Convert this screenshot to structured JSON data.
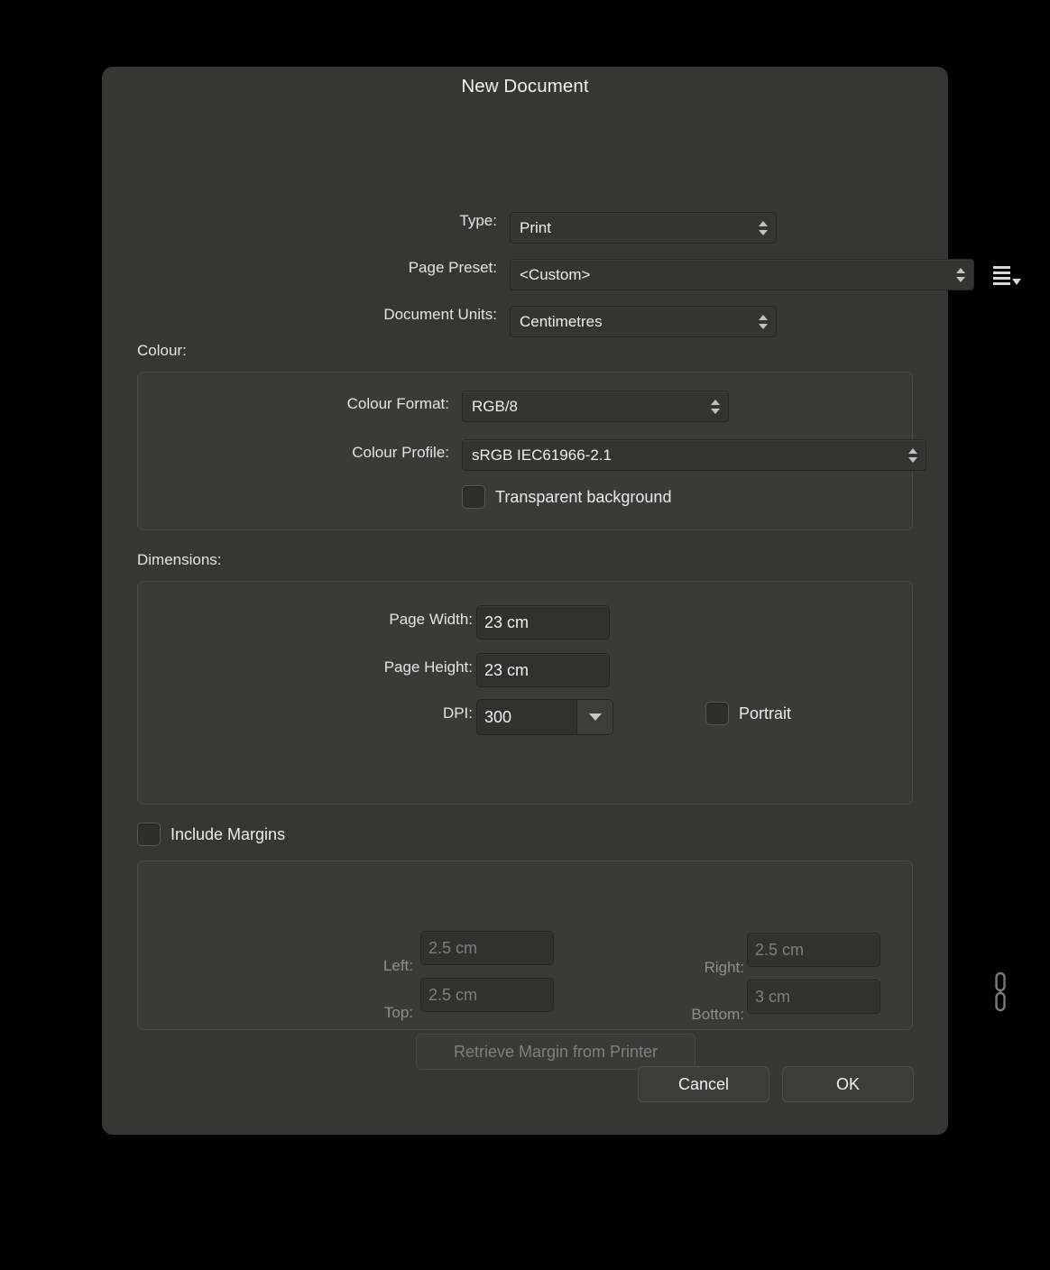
{
  "dialog": {
    "title": "New Document"
  },
  "top_fields": [
    {
      "label": "Type:",
      "value": "Print",
      "control": "select"
    },
    {
      "label": "Page Preset:",
      "value": "<Custom>",
      "control": "select"
    },
    {
      "label": "Document Units:",
      "value": "Centimetres",
      "control": "select"
    }
  ],
  "preset_menu": {
    "icon": "list-menu-icon"
  },
  "colour": {
    "group_label": "Colour:",
    "format_label": "Colour Format:",
    "format_value": "RGB/8",
    "profile_label": "Colour Profile:",
    "profile_value": "sRGB IEC61966-2.1",
    "transparent_label": "Transparent background",
    "transparent_checked": false
  },
  "dimensions": {
    "group_label": "Dimensions:",
    "width_label": "Page Width:",
    "width_value": "23 cm",
    "height_label": "Page Height:",
    "height_value": "23 cm",
    "dpi_label": "DPI:",
    "dpi_value": "300",
    "portrait_label": "Portrait",
    "portrait_checked": false
  },
  "margins": {
    "include_label": "Include Margins",
    "include_checked": false,
    "left_label": "Left:",
    "left_value": "2.5 cm",
    "right_label": "Right:",
    "right_value": "2.5 cm",
    "top_label": "Top:",
    "top_value": "2.5 cm",
    "bottom_label": "Bottom:",
    "bottom_value": "3 cm",
    "retrieve_label": "Retrieve Margin from Printer",
    "link_icon": "chain-link-icon"
  },
  "footer": {
    "cancel_label": "Cancel",
    "ok_label": "OK"
  },
  "colors": {
    "background": "#000000",
    "dialog": "#363634",
    "panel": "#3a3a38",
    "field": "#313130",
    "text": "#e8e8e8",
    "text_disabled": "#7f7f7f"
  }
}
